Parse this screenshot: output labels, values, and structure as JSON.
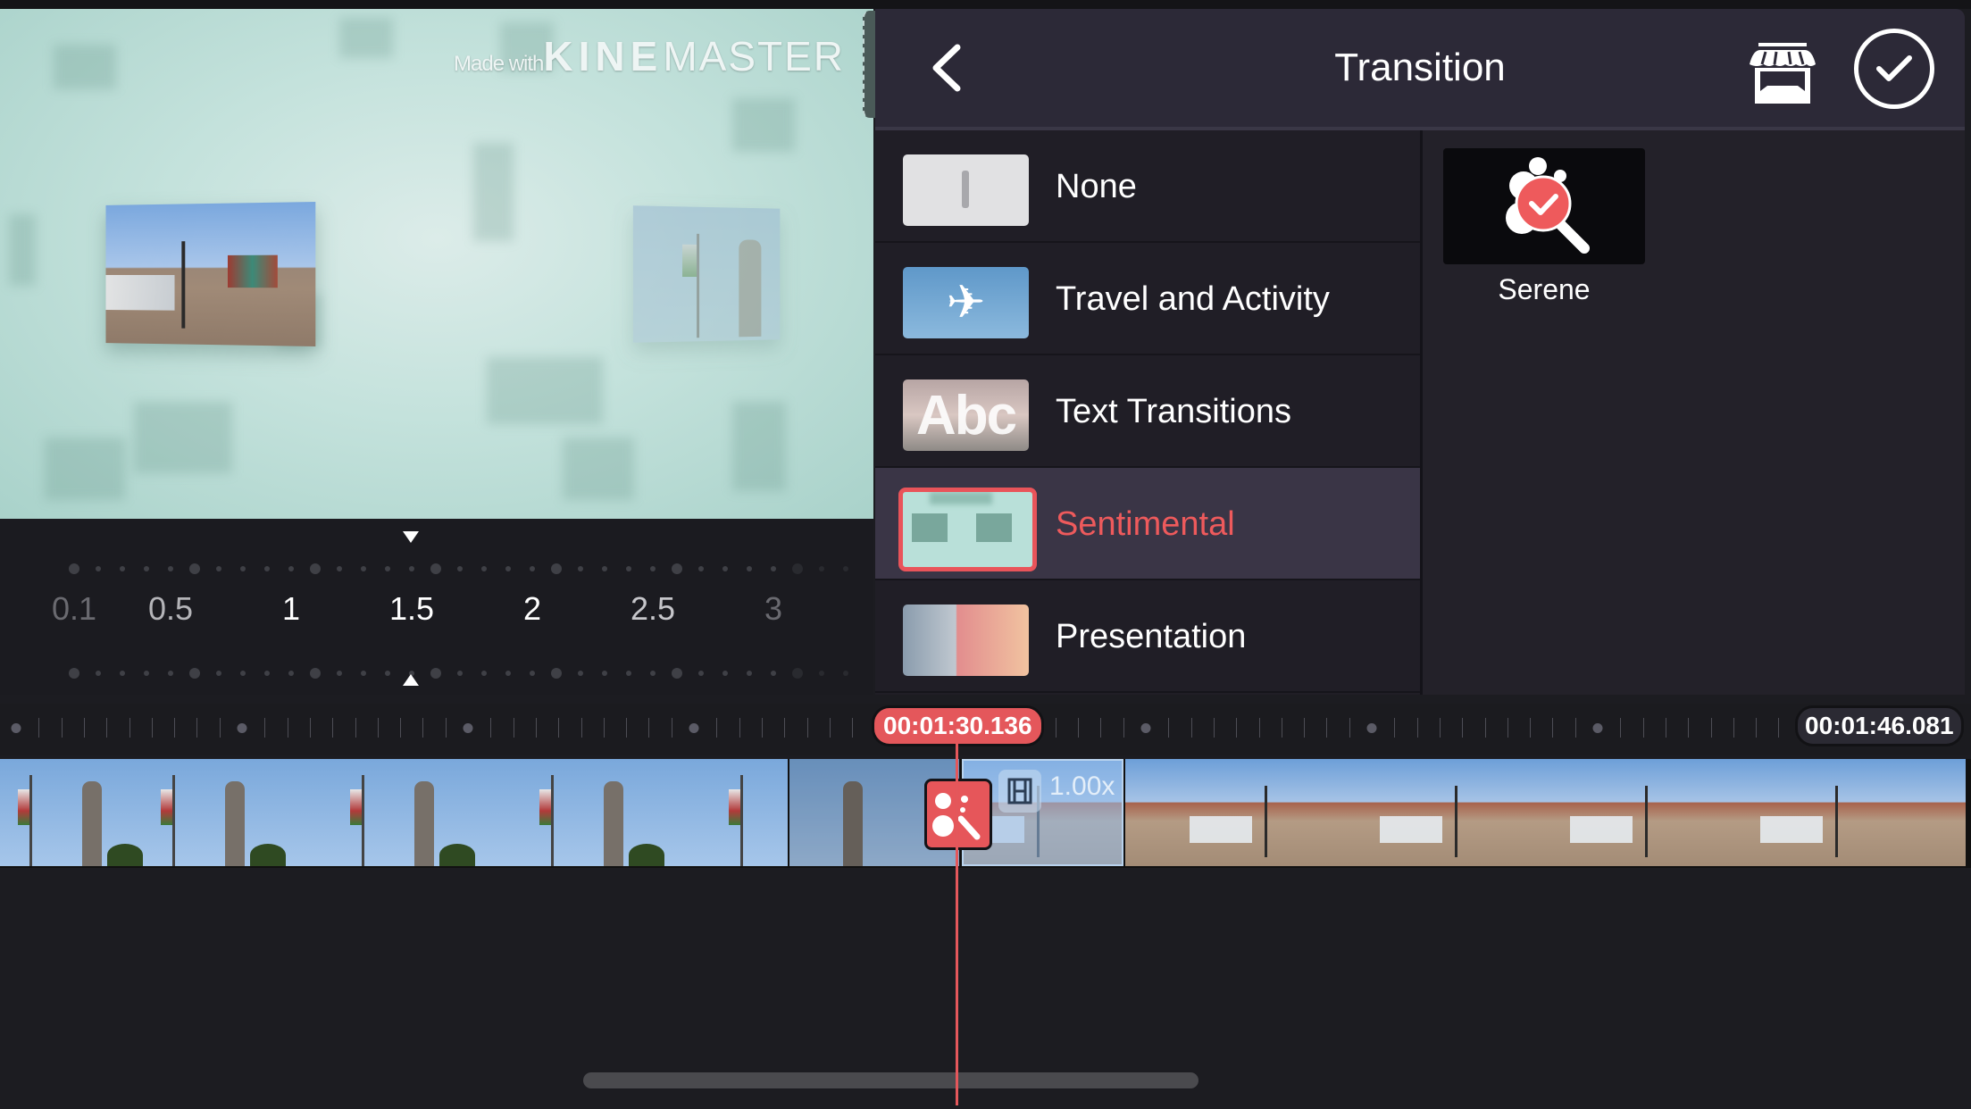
{
  "preview": {
    "watermark": {
      "made_with": "Made with",
      "brand_bold": "KINE",
      "brand_light": "MASTER"
    }
  },
  "speed_scale": {
    "labels": [
      "0.1",
      "0.5",
      "1",
      "1.5",
      "2",
      "2.5",
      "3"
    ],
    "selected": "1.5"
  },
  "panel": {
    "title": "Transition",
    "back_icon": "chevron-left-icon",
    "store_icon": "store-icon",
    "confirm_icon": "check-circle-icon",
    "categories": [
      {
        "label": "None",
        "icon": "none-thumb",
        "selected": false
      },
      {
        "label": "Travel and Activity",
        "icon": "airplane-thumb",
        "selected": false
      },
      {
        "label": "Text Transitions",
        "icon": "abc-thumb",
        "thumb_text": "Abc",
        "selected": false
      },
      {
        "label": "Sentimental",
        "icon": "sentimental-thumb",
        "selected": true
      },
      {
        "label": "Presentation",
        "icon": "presentation-thumb",
        "selected": false
      }
    ],
    "items": [
      {
        "label": "Serene",
        "icon": "serene-check-magnifier-icon"
      }
    ]
  },
  "timeline": {
    "current_time": "00:01:30.136",
    "total_time": "00:01:46.081",
    "clip_speed": "1.00x"
  },
  "colors": {
    "accent": "#e4575b",
    "panel_bg": "#222029",
    "header_bg": "#2c2937",
    "selected_row_bg": "#3a3546"
  }
}
